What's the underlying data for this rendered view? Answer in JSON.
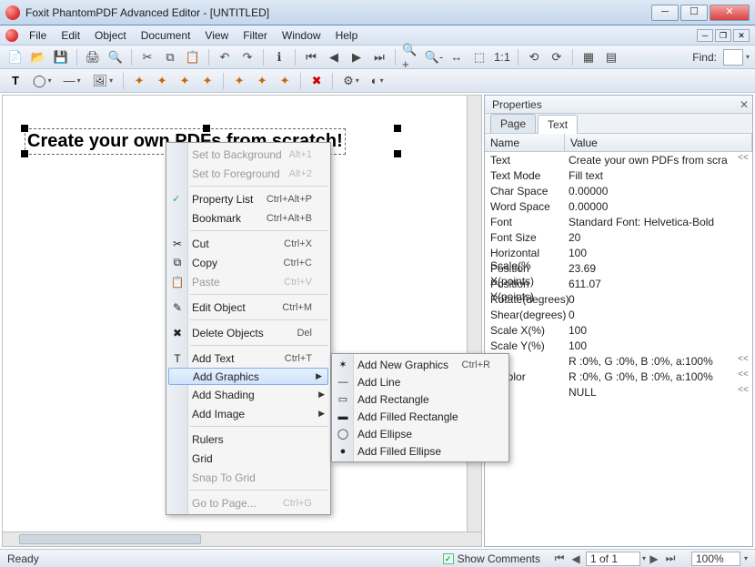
{
  "window": {
    "title": "Foxit PhantomPDF Advanced Editor - [UNTITLED]"
  },
  "menus": [
    "File",
    "Edit",
    "Object",
    "Document",
    "View",
    "Filter",
    "Window",
    "Help"
  ],
  "find_label": "Find:",
  "canvas_text": "Create your own PDFs from scratch!",
  "properties": {
    "title": "Properties",
    "tabs": [
      "Page",
      "Text"
    ],
    "head_name": "Name",
    "head_value": "Value",
    "rows": [
      {
        "n": "Text",
        "v": "Create your own PDFs from scra",
        "e": "<<"
      },
      {
        "n": "Text Mode",
        "v": "Fill text",
        "e": ""
      },
      {
        "n": "Char Space",
        "v": "0.00000",
        "e": ""
      },
      {
        "n": "Word Space",
        "v": "0.00000",
        "e": ""
      },
      {
        "n": "Font",
        "v": "Standard Font: Helvetica-Bold",
        "e": ""
      },
      {
        "n": "Font Size",
        "v": "20",
        "e": ""
      },
      {
        "n": "Horizontal Scale(%",
        "v": "100",
        "e": ""
      },
      {
        "n": "Position X(points)",
        "v": "23.69",
        "e": ""
      },
      {
        "n": "Position Y(points)",
        "v": "611.07",
        "e": ""
      },
      {
        "n": "Rotate(degrees)",
        "v": "0",
        "e": ""
      },
      {
        "n": "Shear(degrees)",
        "v": "0",
        "e": ""
      },
      {
        "n": "Scale X(%)",
        "v": "100",
        "e": ""
      },
      {
        "n": "Scale Y(%)",
        "v": "100",
        "e": ""
      },
      {
        "n": "or",
        "v": "R :0%, G :0%, B :0%, a:100%",
        "e": "<<"
      },
      {
        "n": "e Color",
        "v": "R :0%, G :0%, B :0%, a:100%",
        "e": "<<"
      },
      {
        "n": "g",
        "v": "NULL",
        "e": "<<"
      }
    ]
  },
  "context": {
    "items": [
      {
        "label": "Set to Background",
        "shortcut": "Alt+1",
        "disabled": true
      },
      {
        "label": "Set to Foreground",
        "shortcut": "Alt+2",
        "disabled": true
      },
      {
        "sep": true
      },
      {
        "label": "Property List",
        "shortcut": "Ctrl+Alt+P",
        "checked": true
      },
      {
        "label": "Bookmark",
        "shortcut": "Ctrl+Alt+B"
      },
      {
        "sep": true
      },
      {
        "label": "Cut",
        "shortcut": "Ctrl+X",
        "icon": "cut"
      },
      {
        "label": "Copy",
        "shortcut": "Ctrl+C",
        "icon": "copy"
      },
      {
        "label": "Paste",
        "shortcut": "Ctrl+V",
        "disabled": true,
        "icon": "paste"
      },
      {
        "sep": true
      },
      {
        "label": "Edit Object",
        "shortcut": "Ctrl+M",
        "icon": "edit"
      },
      {
        "sep": true
      },
      {
        "label": "Delete Objects",
        "shortcut": "Del",
        "icon": "delete"
      },
      {
        "sep": true
      },
      {
        "label": "Add Text",
        "shortcut": "Ctrl+T",
        "icon": "text"
      },
      {
        "label": "Add Graphics",
        "sub": true,
        "hl": true
      },
      {
        "label": "Add Shading",
        "sub": true
      },
      {
        "label": "Add Image",
        "sub": true
      },
      {
        "sep": true
      },
      {
        "label": "Rulers"
      },
      {
        "label": "Grid"
      },
      {
        "label": "Snap To Grid",
        "disabled": true
      },
      {
        "sep": true
      },
      {
        "label": "Go to Page...",
        "shortcut": "Ctrl+G",
        "disabled": true
      }
    ]
  },
  "submenu": {
    "items": [
      {
        "label": "Add New Graphics",
        "shortcut": "Ctrl+R",
        "icon": "new"
      },
      {
        "label": "Add Line",
        "icon": "line"
      },
      {
        "label": "Add Rectangle",
        "icon": "rect"
      },
      {
        "label": "Add Filled Rectangle",
        "icon": "frect"
      },
      {
        "label": "Add Ellipse",
        "icon": "ellipse"
      },
      {
        "label": "Add Filled Ellipse",
        "icon": "fellipse"
      }
    ]
  },
  "status": {
    "ready": "Ready",
    "show_comments": "Show Comments",
    "page_display": "1 of 1",
    "zoom": "100%"
  }
}
